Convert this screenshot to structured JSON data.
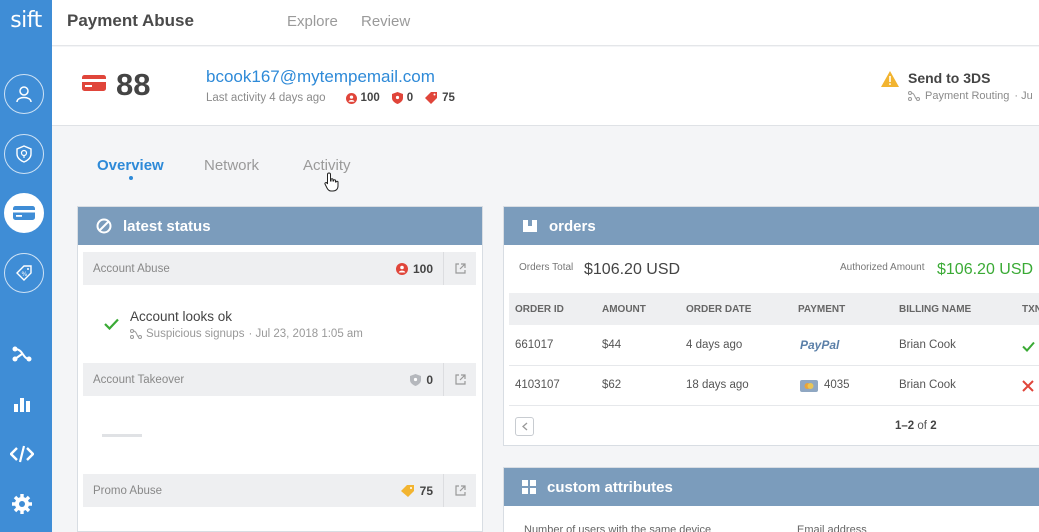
{
  "sidebar": {
    "logo": "sift",
    "items": [
      {
        "icon": "user-icon"
      },
      {
        "icon": "shield-bulb-icon"
      },
      {
        "icon": "credit-card-icon",
        "active": true
      },
      {
        "icon": "promo-tag-icon"
      },
      {
        "icon": "workflow-icon"
      },
      {
        "icon": "bar-chart-icon"
      },
      {
        "icon": "code-icon"
      },
      {
        "icon": "gear-icon"
      }
    ]
  },
  "topbar": {
    "title": "Payment Abuse",
    "links": [
      "Explore",
      "Review"
    ]
  },
  "header": {
    "score": "88",
    "email": "bcook167@mytempemail.com",
    "last_activity": "Last activity 4 days ago",
    "badges": {
      "account_abuse": "100",
      "account_takeover": "0",
      "promo_abuse": "75"
    },
    "action_title": "Send to 3DS",
    "action_sub": "Payment Routing",
    "action_sub_trail": "· Ju"
  },
  "tabs": [
    "Overview",
    "Network",
    "Activity"
  ],
  "latest_status": {
    "title": "latest status",
    "account_abuse": {
      "label": "Account Abuse",
      "score": "100"
    },
    "status_text": "Account looks ok",
    "status_sub": "Suspicious signups",
    "status_time": "· Jul 23, 2018 1:05 am",
    "account_takeover": {
      "label": "Account Takeover",
      "score": "0"
    },
    "promo_abuse": {
      "label": "Promo Abuse",
      "score": "75"
    }
  },
  "orders": {
    "title": "orders",
    "orders_total_label": "Orders Total",
    "orders_total": "$106.20 USD",
    "authorized_label": "Authorized Amount",
    "authorized": "$106.20 USD",
    "columns": [
      "ORDER ID",
      "AMOUNT",
      "ORDER DATE",
      "PAYMENT",
      "BILLING NAME",
      "TXN"
    ],
    "rows": [
      {
        "id": "661017",
        "amount": "$44",
        "date": "4 days ago",
        "payment": "PayPal",
        "name": "Brian Cook",
        "status": "ok"
      },
      {
        "id": "4103107",
        "amount": "$62",
        "date": "18 days ago",
        "payment": "4035",
        "name": "Brian Cook",
        "status": "fail"
      }
    ],
    "pager_range": "1–2",
    "pager_of": "of",
    "pager_total": "2"
  },
  "custom_attributes": {
    "title": "custom attributes",
    "label_1": "Number of users with the same device",
    "label_2": "Email address"
  },
  "colors": {
    "sidebar": "#3f8dd6",
    "accent": "#2e8ad8",
    "panel_head": "#7b9cbc",
    "success": "#3aaa35",
    "danger": "#e0453a"
  }
}
